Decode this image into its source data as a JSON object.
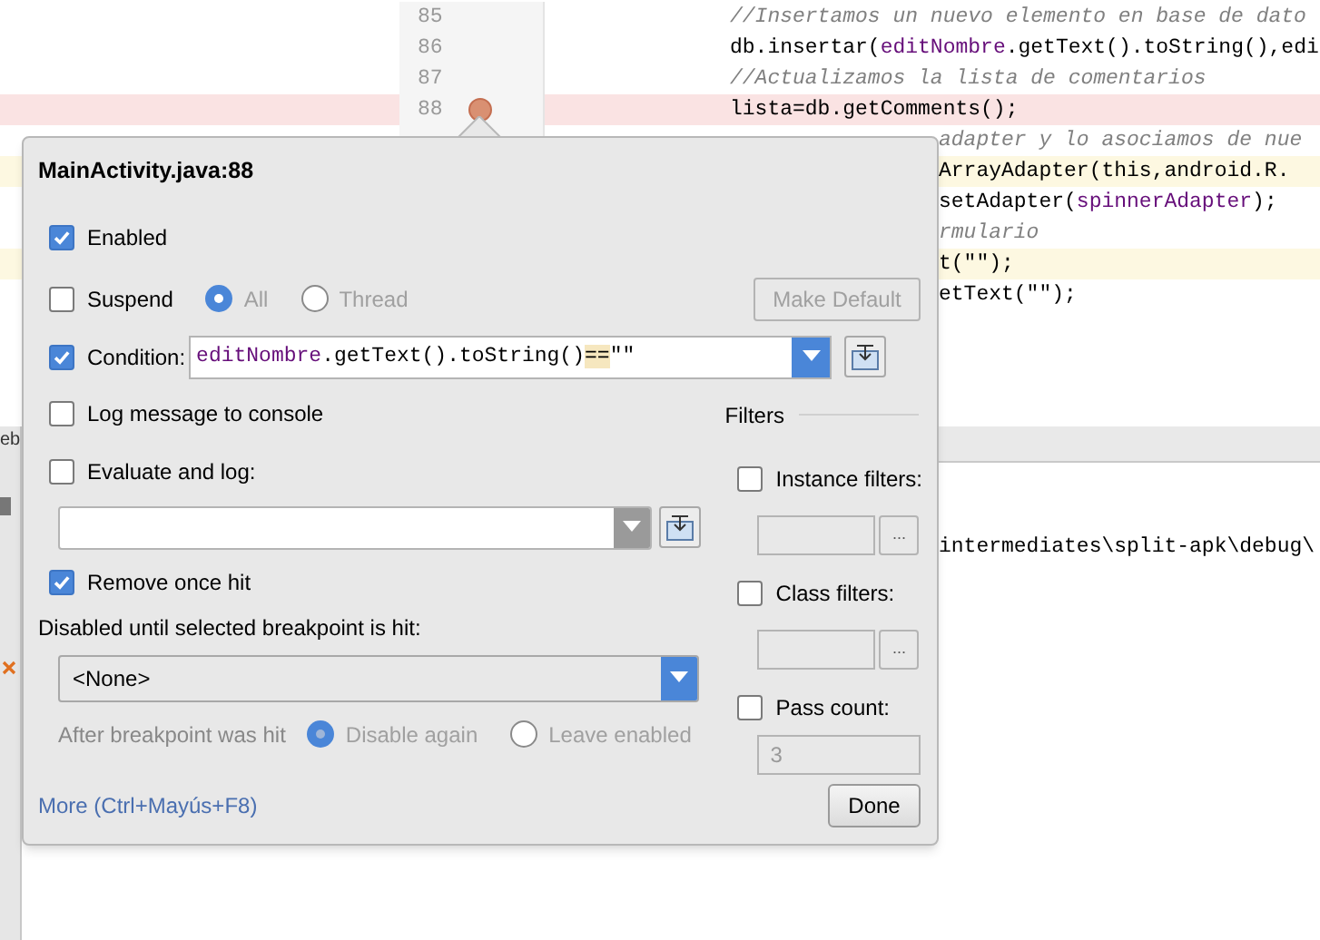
{
  "editor": {
    "lines": [
      {
        "number": "85",
        "kind": "normal",
        "parts": [
          {
            "kind": "comment",
            "text": "//Insertamos un nuevo elemento en base de dato"
          }
        ]
      },
      {
        "number": "86",
        "kind": "normal",
        "parts": [
          {
            "kind": "plain",
            "text": "db.insertar("
          },
          {
            "kind": "field",
            "text": "editNombre"
          },
          {
            "kind": "plain",
            "text": ".getText().toString(),edi"
          }
        ]
      },
      {
        "number": "87",
        "kind": "normal",
        "parts": [
          {
            "kind": "comment",
            "text": "//Actualizamos la lista de comentarios"
          }
        ]
      },
      {
        "number": "88",
        "kind": "breakpoint",
        "parts": [
          {
            "kind": "plain",
            "text": "lista=db.getComments();"
          }
        ]
      },
      {
        "kind": "normal",
        "parts": [
          {
            "kind": "comment",
            "text": "adapter y lo asociamos de nue"
          }
        ]
      },
      {
        "kind": "warning",
        "parts": [
          {
            "kind": "plain",
            "text": "ArrayAdapter(this,android.R."
          }
        ]
      },
      {
        "kind": "normal",
        "parts": [
          {
            "kind": "plain",
            "text": "setAdapter("
          },
          {
            "kind": "field",
            "text": "spinnerAdapter"
          },
          {
            "kind": "plain",
            "text": ");"
          }
        ]
      },
      {
        "kind": "normal",
        "parts": [
          {
            "kind": "comment",
            "text": "rmulario"
          }
        ]
      },
      {
        "kind": "warning",
        "parts": [
          {
            "kind": "plain",
            "text": "t(\"\");"
          }
        ]
      },
      {
        "kind": "normal",
        "parts": [
          {
            "kind": "plain",
            "text": "etText(\"\");"
          }
        ]
      }
    ]
  },
  "side_tab": "eb",
  "console": {
    "line": "intermediates\\split-apk\\debug\\"
  },
  "popup": {
    "title": "MainActivity.java:88",
    "enabled": {
      "label": "Enabled",
      "checked": true
    },
    "suspend": {
      "label": "Suspend",
      "checked": false
    },
    "suspend_options": [
      {
        "label": "All",
        "selected": true
      },
      {
        "label": "Thread",
        "selected": false
      }
    ],
    "make_default": "Make Default",
    "condition": {
      "label": "Condition:",
      "checked": true,
      "parts": [
        {
          "kind": "field",
          "text": "editNombre"
        },
        {
          "kind": "plain",
          "text": ".getText().toString()"
        },
        {
          "kind": "match",
          "text": "=="
        },
        {
          "kind": "plain",
          "text": "\"\""
        }
      ]
    },
    "log_message": {
      "label": "Log message to console",
      "checked": false
    },
    "evaluate": {
      "label": "Evaluate and log:",
      "checked": false
    },
    "remove_once_hit": {
      "label": "Remove once hit",
      "checked": true
    },
    "disabled_until": {
      "label": "Disabled until selected breakpoint is hit:",
      "value": "<None>"
    },
    "after_hit": {
      "label": "After breakpoint was hit",
      "options": [
        {
          "label": "Disable again",
          "selected": true
        },
        {
          "label": "Leave enabled",
          "selected": false
        }
      ]
    },
    "filters": {
      "title": "Filters",
      "instance": {
        "label": "Instance filters:",
        "checked": false
      },
      "class": {
        "label": "Class filters:",
        "checked": false
      },
      "pass_count": {
        "label": "Pass count:",
        "checked": false,
        "value": "3"
      },
      "browse": "..."
    },
    "more_link": "More (Ctrl+Mayús+F8)",
    "done": "Done"
  }
}
